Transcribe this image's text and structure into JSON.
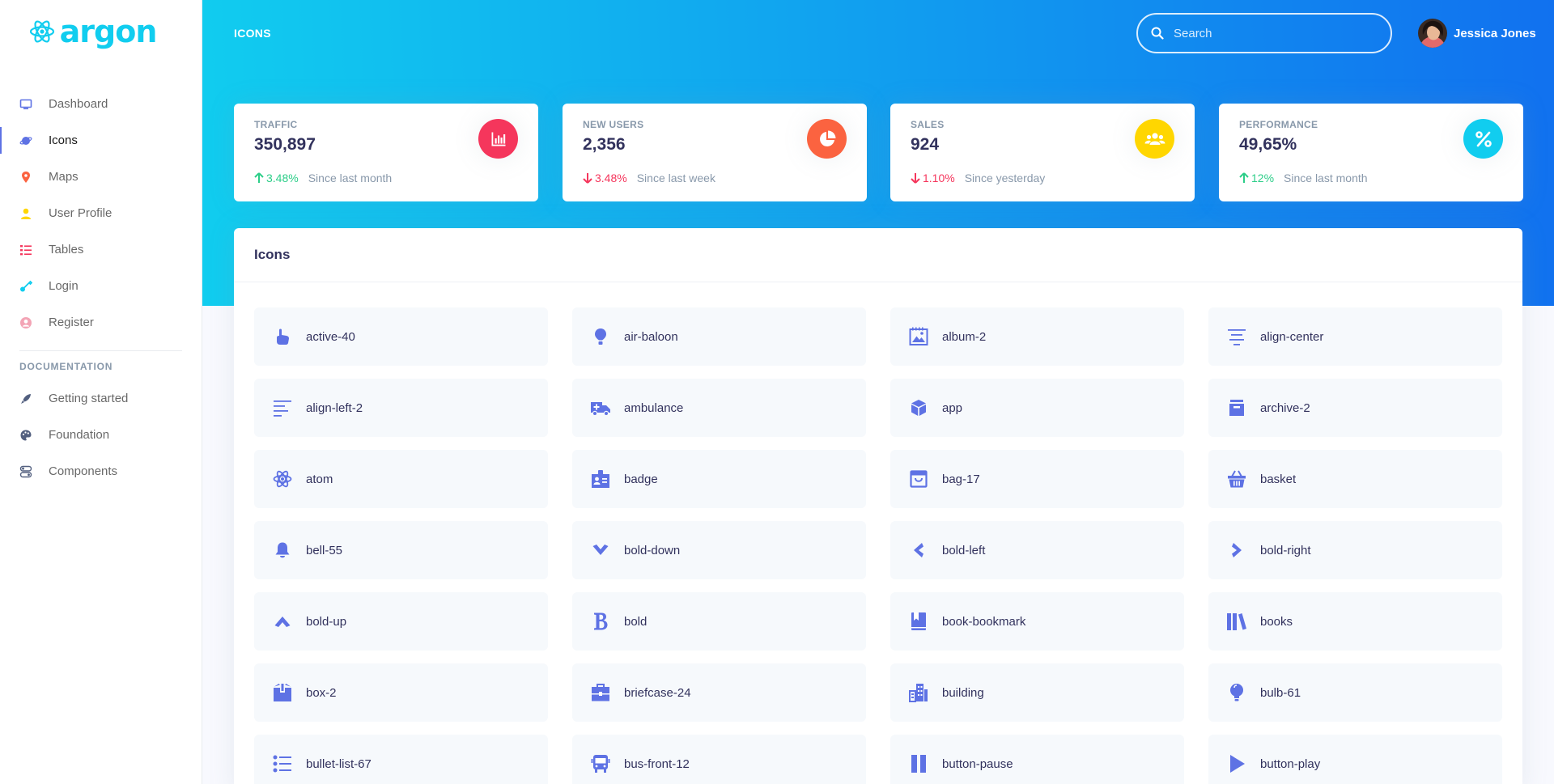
{
  "brand": {
    "name": "argon"
  },
  "sidebar": {
    "items": [
      {
        "label": "Dashboard",
        "icon": "tv-icon",
        "color": "#5e72e4"
      },
      {
        "label": "Icons",
        "icon": "planet-icon",
        "color": "#5e72e4"
      },
      {
        "label": "Maps",
        "icon": "pin-icon",
        "color": "#fb6340"
      },
      {
        "label": "User Profile",
        "icon": "single-user-icon",
        "color": "#ffd600"
      },
      {
        "label": "Tables",
        "icon": "bullet-list-icon",
        "color": "#f5365c"
      },
      {
        "label": "Login",
        "icon": "key-icon",
        "color": "#11cdef"
      },
      {
        "label": "Register",
        "icon": "circle-user-icon",
        "color": "#f3a4b5"
      }
    ],
    "doc_heading": "DOCUMENTATION",
    "doc_items": [
      {
        "label": "Getting started",
        "icon": "spaceship-icon"
      },
      {
        "label": "Foundation",
        "icon": "palette-icon"
      },
      {
        "label": "Components",
        "icon": "components-icon"
      }
    ]
  },
  "header": {
    "title": "ICONS",
    "search_placeholder": "Search",
    "user_name": "Jessica Jones"
  },
  "stats": [
    {
      "label": "TRAFFIC",
      "value": "350,897",
      "change": "3.48%",
      "direction": "up",
      "since": "Since last month",
      "icon": "chart-bar-icon",
      "color": "#f5365c"
    },
    {
      "label": "NEW USERS",
      "value": "2,356",
      "change": "3.48%",
      "direction": "down",
      "since": "Since last week",
      "icon": "chart-pie-icon",
      "color": "#fb6340"
    },
    {
      "label": "SALES",
      "value": "924",
      "change": "1.10%",
      "direction": "down",
      "since": "Since yesterday",
      "icon": "users-icon",
      "color": "#ffd600"
    },
    {
      "label": "PERFORMANCE",
      "value": "49,65%",
      "change": "12%",
      "direction": "up",
      "since": "Since last month",
      "icon": "percent-icon",
      "color": "#11cdef"
    }
  ],
  "panel": {
    "title": "Icons",
    "icons": [
      "active-40",
      "air-baloon",
      "album-2",
      "align-center",
      "align-left-2",
      "ambulance",
      "app",
      "archive-2",
      "atom",
      "badge",
      "bag-17",
      "basket",
      "bell-55",
      "bold-down",
      "bold-left",
      "bold-right",
      "bold-up",
      "bold",
      "book-bookmark",
      "books",
      "box-2",
      "briefcase-24",
      "building",
      "bulb-61",
      "bullet-list-67",
      "bus-front-12",
      "button-pause",
      "button-play"
    ]
  }
}
